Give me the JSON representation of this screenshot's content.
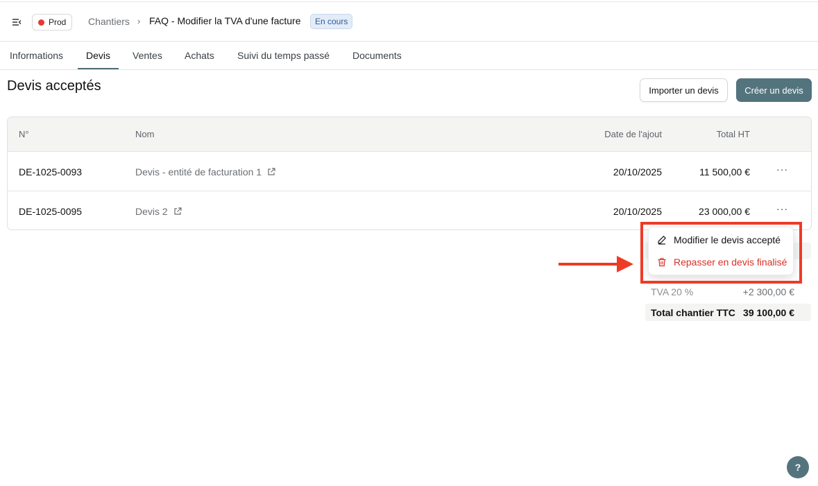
{
  "header": {
    "environment": "Prod",
    "breadcrumb_root": "Chantiers",
    "breadcrumb_sep": "›",
    "breadcrumb_current": "FAQ - Modifier la TVA d'une facture",
    "status": "En cours"
  },
  "tabs": [
    {
      "label": "Informations",
      "active": false
    },
    {
      "label": "Devis",
      "active": true
    },
    {
      "label": "Ventes",
      "active": false
    },
    {
      "label": "Achats",
      "active": false
    },
    {
      "label": "Suivi du temps passé",
      "active": false
    },
    {
      "label": "Documents",
      "active": false
    }
  ],
  "page": {
    "title": "Devis acceptés",
    "import_button": "Importer un devis",
    "create_button": "Créer un devis"
  },
  "table": {
    "columns": [
      "N°",
      "Nom",
      "Date de l'ajout",
      "Total HT"
    ],
    "rows": [
      {
        "number": "DE-1025-0093",
        "name": "Devis - entité de facturation 1",
        "date": "20/10/2025",
        "total": "11 500,00 €",
        "more": "···"
      },
      {
        "number": "DE-1025-0095",
        "name": "Devis 2",
        "date": "20/10/2025",
        "total": "23 000,00 €",
        "more": "···"
      }
    ]
  },
  "summary": {
    "tva_label": "TVA 20 %",
    "tva_value": "+2 300,00 €",
    "total_label": "Total chantier TTC",
    "total_value": "39 100,00 €"
  },
  "dropdown": {
    "edit_label": "Modifier le devis accepté",
    "revert_label": "Repasser en devis finalisé"
  },
  "help": "?",
  "colors": {
    "accent": "#53747d",
    "danger": "#d93025",
    "highlight": "#ee3b26",
    "status_bg": "#e3ecf7"
  },
  "icons": [
    "sidebar-toggle-icon",
    "status-dot-icon",
    "external-link-icon",
    "pencil-icon",
    "trash-icon",
    "arrow-right-icon",
    "help-icon"
  ]
}
